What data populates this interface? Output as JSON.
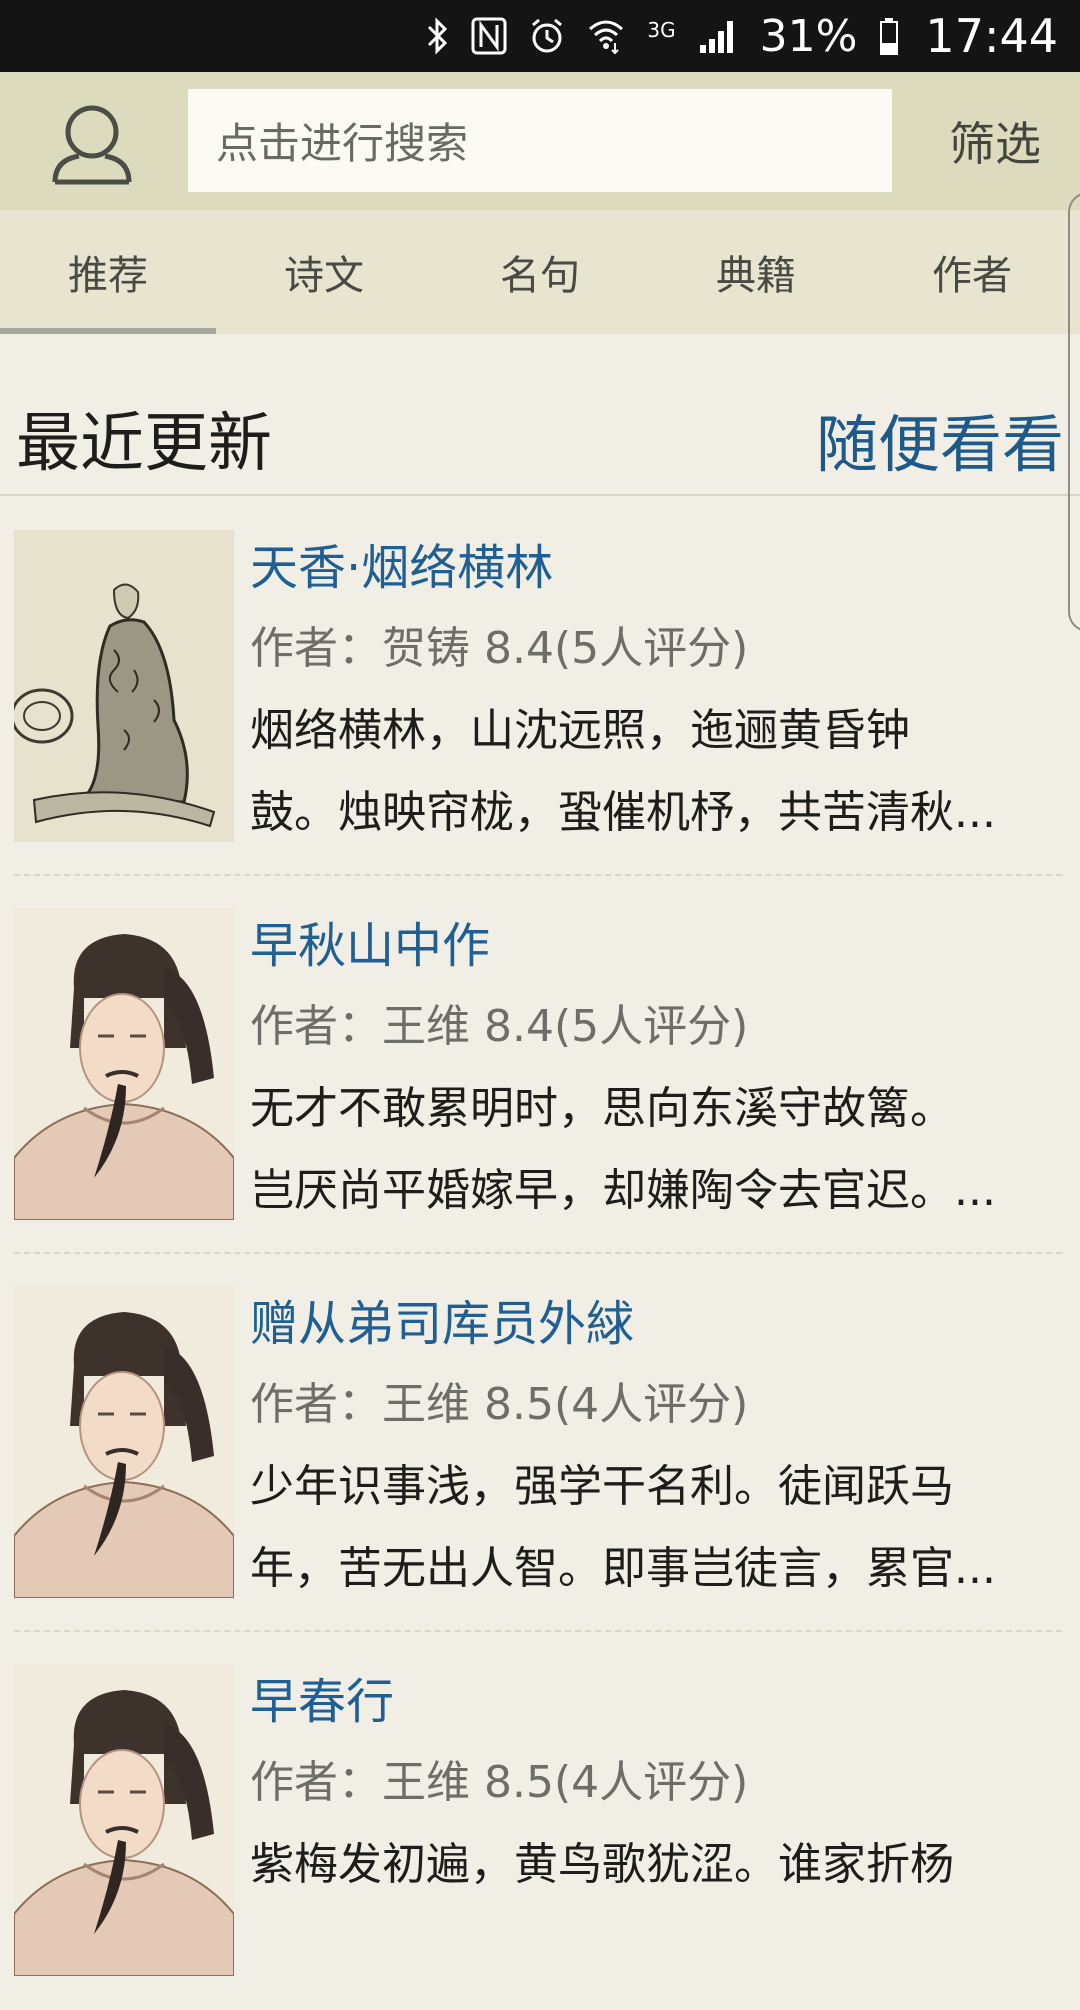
{
  "status_bar": {
    "network": "3G",
    "battery_percent": "31%",
    "time": "17:44",
    "icons": [
      "bluetooth-icon",
      "nfc-icon",
      "alarm-icon",
      "wifi-icon",
      "signal-icon",
      "battery-icon"
    ]
  },
  "header": {
    "search_placeholder": "点击进行搜索",
    "filter_label": "筛选"
  },
  "tabs": [
    {
      "label": "推荐",
      "active": true
    },
    {
      "label": "诗文",
      "active": false
    },
    {
      "label": "名句",
      "active": false
    },
    {
      "label": "典籍",
      "active": false
    },
    {
      "label": "作者",
      "active": false
    }
  ],
  "section": {
    "title": "最近更新",
    "random_link": "随便看看"
  },
  "poems": [
    {
      "title": "天香·烟络横林",
      "meta": "作者：贺铸 8.4(5人评分)",
      "line1": "烟络横林，山沈远照，迤逦黄昏钟",
      "line2": "鼓。烛映帘栊，蛩催机杼，共苦清秋...",
      "thumb": "sketch"
    },
    {
      "title": "早秋山中作",
      "meta": "作者：王维 8.4(5人评分)",
      "line1": "无才不敢累明时，思向东溪守故篱。",
      "line2": "岂厌尚平婚嫁早，却嫌陶令去官迟。...",
      "thumb": "portrait"
    },
    {
      "title": "赠从弟司库员外絿",
      "meta": "作者：王维 8.5(4人评分)",
      "line1": "少年识事浅，强学干名利。徒闻跃马",
      "line2": "年，苦无出人智。即事岂徒言，累官...",
      "thumb": "portrait"
    },
    {
      "title": "早春行",
      "meta": "作者：王维 8.5(4人评分)",
      "line1": "紫梅发初遍，黄鸟歌犹涩。谁家折杨",
      "line2": "",
      "thumb": "portrait"
    }
  ]
}
